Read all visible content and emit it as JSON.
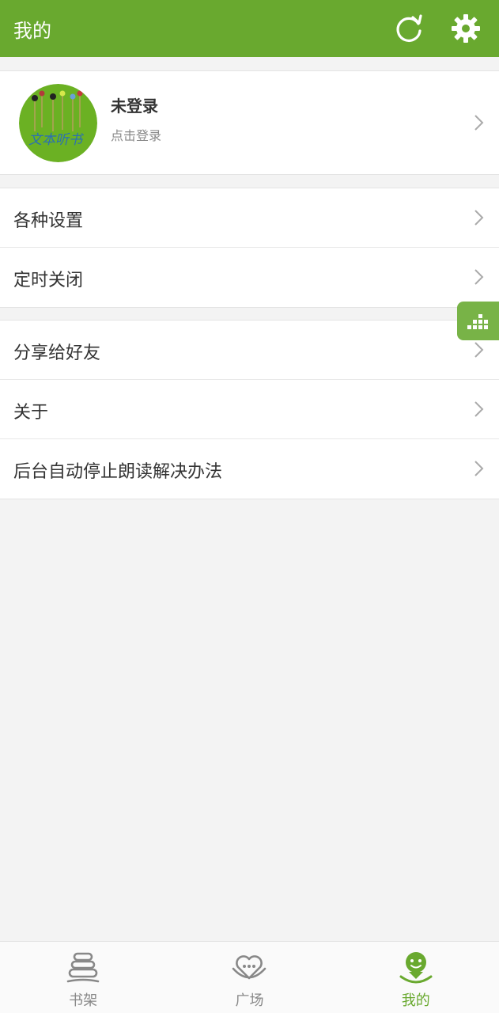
{
  "header": {
    "title": "我的",
    "refresh_icon": "refresh-icon",
    "settings_icon": "gear-icon"
  },
  "profile": {
    "name": "未登录",
    "subtitle": "点击登录",
    "avatar_text": "文本听书"
  },
  "menu_group_1": [
    {
      "label": "各种设置"
    },
    {
      "label": "定时关闭"
    }
  ],
  "menu_group_2": [
    {
      "label": "分享给好友"
    },
    {
      "label": "关于"
    },
    {
      "label": "后台自动停止朗读解决办法"
    }
  ],
  "floating_button": {
    "icon": "equalizer-icon"
  },
  "bottom_nav": {
    "items": [
      {
        "label": "书架",
        "icon": "bookshelf-icon"
      },
      {
        "label": "广场",
        "icon": "square-heart-icon"
      },
      {
        "label": "我的",
        "icon": "profile-face-icon"
      }
    ],
    "active_index": 2
  },
  "colors": {
    "brand": "#69a92f",
    "background": "#f3f3f3"
  }
}
